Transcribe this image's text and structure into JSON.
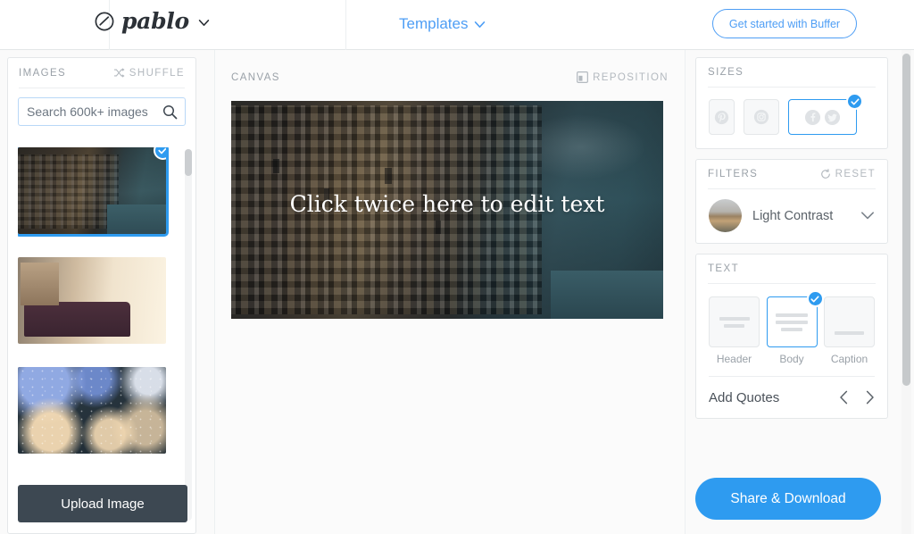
{
  "app": {
    "brand_name": "pablo",
    "brand_icon": "pablo-circle-slash-logo",
    "brand_caret_icon": "chevron-down-icon"
  },
  "header": {
    "templates_label": "Templates",
    "templates_caret_icon": "chevron-down-icon",
    "cta_label": "Get started with Buffer",
    "accent_color": "#4e9ef5"
  },
  "images_panel": {
    "title": "IMAGES",
    "shuffle_label": "SHUFFLE",
    "shuffle_icon": "shuffle-icon",
    "search": {
      "value": "",
      "placeholder": "Search 600k+ images",
      "icon": "search-icon"
    },
    "thumbnails": [
      {
        "name": "cliffside-village",
        "selected": true,
        "check_icon": "check-icon"
      },
      {
        "name": "sofa-sunlit-room",
        "selected": false,
        "check_icon": ""
      },
      {
        "name": "rainy-window",
        "selected": false,
        "check_icon": ""
      }
    ],
    "upload_label": "Upload Image"
  },
  "canvas_panel": {
    "title": "CANVAS",
    "reposition_label": "REPOSITION",
    "reposition_icon": "reposition-icon",
    "photo_name": "cliffside-village",
    "overlay_text": "Click twice here to edit text"
  },
  "sizes_panel": {
    "title": "SIZES",
    "options": [
      {
        "name": "pinterest",
        "icon": "pinterest-icon",
        "selected": false
      },
      {
        "name": "instagram",
        "icon": "instagram-icon",
        "selected": false
      },
      {
        "name": "facebook-twitter",
        "icon": "facebook-twitter-icon",
        "selected": true
      }
    ],
    "selected_check_icon": "check-icon"
  },
  "filters_panel": {
    "title": "FILTERS",
    "reset_label": "RESET",
    "reset_icon": "reset-icon",
    "selected_filter": "Light Contrast",
    "caret_icon": "chevron-down-icon"
  },
  "text_panel": {
    "title": "TEXT",
    "options": [
      {
        "label": "Header",
        "selected": false
      },
      {
        "label": "Body",
        "selected": true
      },
      {
        "label": "Caption",
        "selected": false
      }
    ],
    "selected_check_icon": "check-icon",
    "quotes_label": "Add Quotes",
    "prev_icon": "chevron-left-icon",
    "next_icon": "chevron-right-icon"
  },
  "footer": {
    "share_label": "Share & Download",
    "share_color": "#2e9bf0"
  }
}
